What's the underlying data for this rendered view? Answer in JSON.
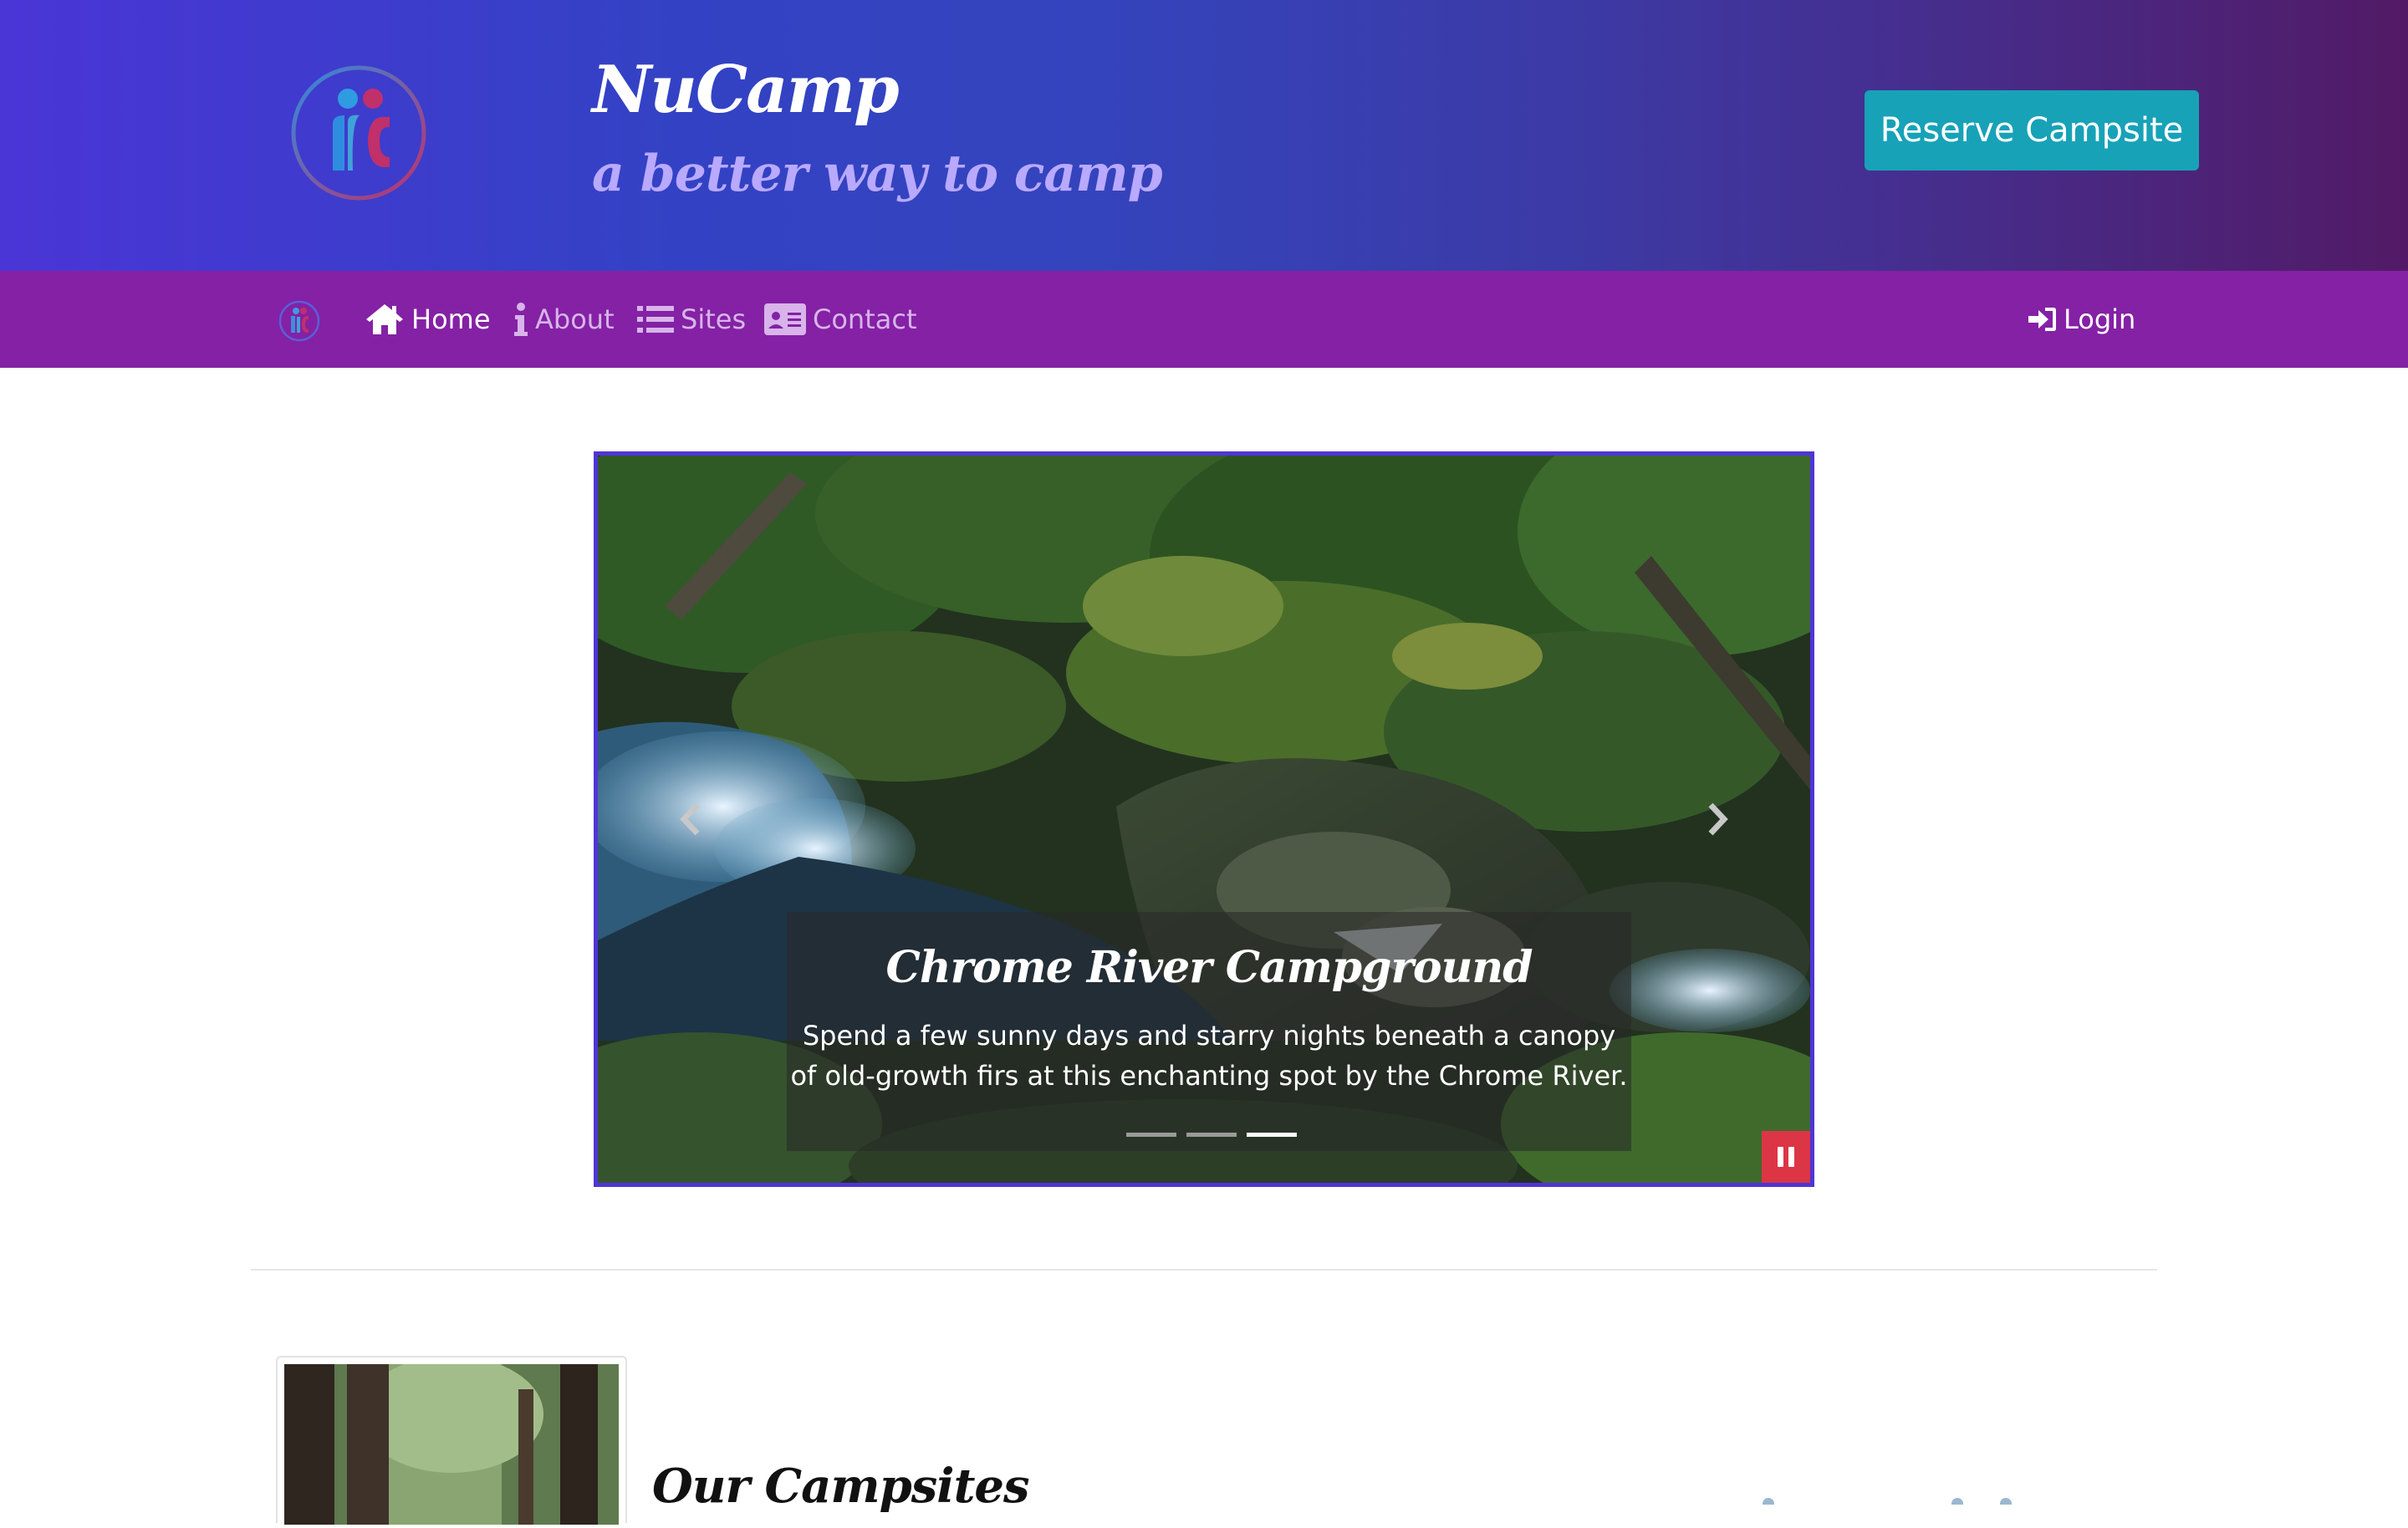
{
  "header": {
    "logo_icon": "nucamp-logo-icon",
    "title": "NuCamp",
    "tagline": "a better way to camp",
    "reserve_button": "Reserve Campsite",
    "colors": {
      "gradient_start": "#4a35d6",
      "gradient_end": "#521a66",
      "reserve_button": "#17a2b8"
    }
  },
  "navbar": {
    "brand_icon": "nucamp-logo-icon",
    "background": "#8421a5",
    "items": [
      {
        "label": "Home",
        "icon": "home-icon",
        "active": true
      },
      {
        "label": "About",
        "icon": "info-icon",
        "active": false
      },
      {
        "label": "Sites",
        "icon": "list-icon",
        "active": false
      },
      {
        "label": "Contact",
        "icon": "address-card-icon",
        "active": false
      }
    ],
    "login": {
      "label": "Login",
      "icon": "sign-in-icon"
    }
  },
  "carousel": {
    "caption_title": "Chrome River Campground",
    "caption_text": "Spend a few sunny days and starry nights beneath a canopy of old-growth firs at this enchanting spot by the Chrome River.",
    "slide_count": 3,
    "active_slide": 3,
    "prev_icon": "chevron-left-icon",
    "next_icon": "chevron-right-icon",
    "pause_icon": "pause-icon",
    "border_color": "#4f35d6",
    "pause_color": "#dc3545"
  },
  "section": {
    "title": "Our Campsites"
  }
}
